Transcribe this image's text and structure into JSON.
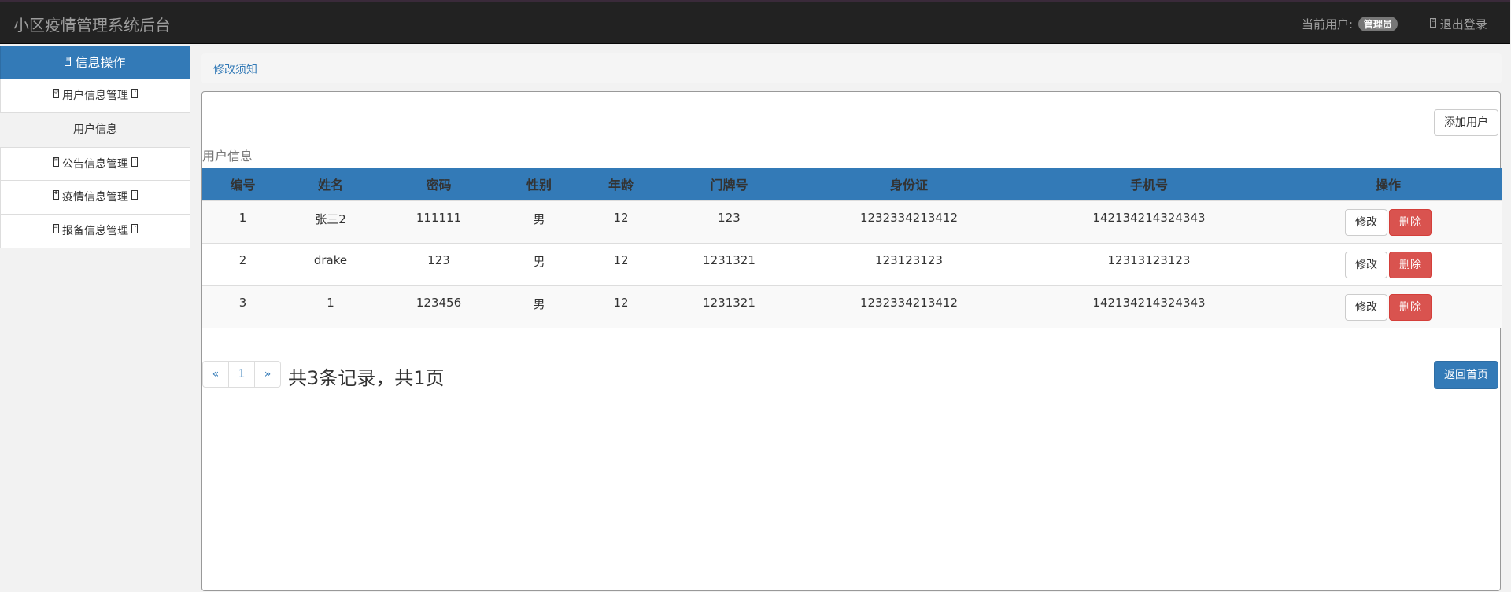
{
  "app": {
    "title": "小区疫情管理系统后台"
  },
  "header": {
    "current_user_label": "当前用户:",
    "role_badge": "管理员",
    "logout_label": "退出登录"
  },
  "sidebar": {
    "heading": "信息操作",
    "items": [
      {
        "label": "用户信息管理"
      },
      {
        "label": "用户信息"
      },
      {
        "label": "公告信息管理"
      },
      {
        "label": "疫情信息管理"
      },
      {
        "label": "报备信息管理"
      }
    ]
  },
  "breadcrumb": {
    "link": "修改须知"
  },
  "main": {
    "add_button": "添加用户",
    "caption": "用户信息",
    "columns": [
      "编号",
      "姓名",
      "密码",
      "性别",
      "年龄",
      "门牌号",
      "身份证",
      "手机号",
      "操作"
    ],
    "rows": [
      [
        "1",
        "张三2",
        "111111",
        "男",
        "12",
        "123",
        "1232334213412",
        "142134214324343"
      ],
      [
        "2",
        "drake",
        "123",
        "男",
        "12",
        "1231321",
        "123123123",
        "12313123123"
      ],
      [
        "3",
        "1",
        "123456",
        "男",
        "12",
        "1231321",
        "1232334213412",
        "142134214324343"
      ]
    ],
    "edit_label": "修改",
    "delete_label": "删除",
    "pagination": {
      "prev": "«",
      "page": "1",
      "next": "»"
    },
    "summary": "共3条记录，共1页",
    "home_button": "返回首页"
  },
  "colors": {
    "primary": "#337ab7",
    "danger": "#d9534f",
    "topbar": "#222222"
  }
}
